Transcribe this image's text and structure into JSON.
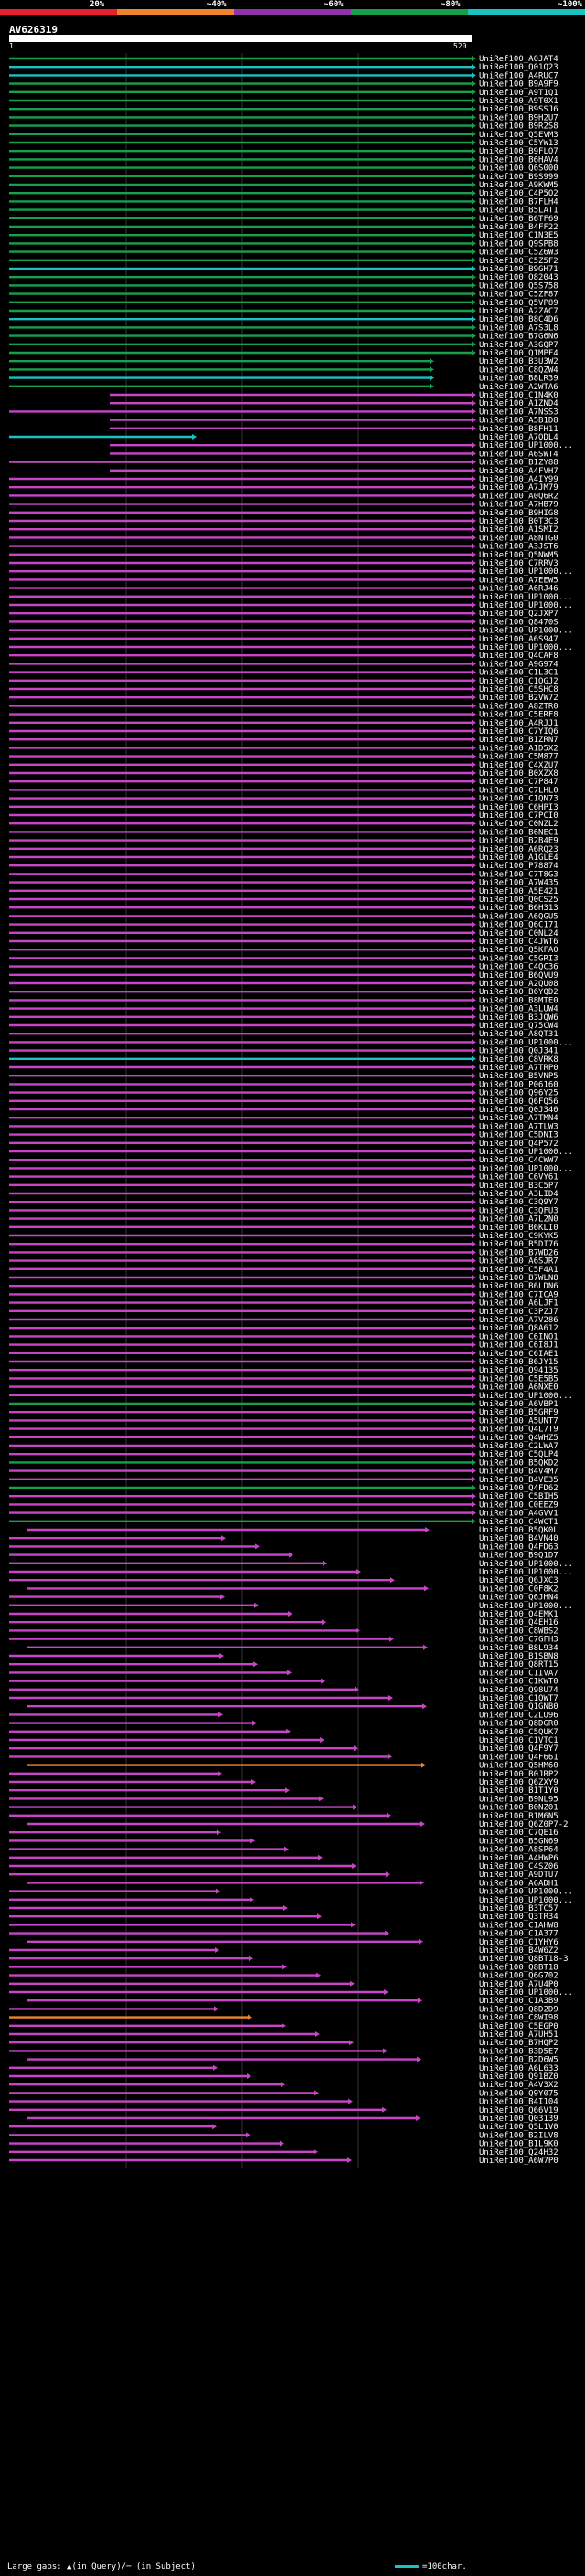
{
  "colorbar": {
    "labels": [
      "20%",
      "~40%",
      "~60%",
      "~80%",
      "~100%"
    ],
    "colors": [
      "#e8202a",
      "#f0842c",
      "#8c34a8",
      "#16a04a",
      "#17c3c3"
    ]
  },
  "query": {
    "name": "AV626319",
    "start": "1",
    "end": "520"
  },
  "colors": {
    "cyan": "#17c3c3",
    "green": "#16a04a",
    "magenta": "#c845c8",
    "orange": "#f0842c",
    "gapline": "#ff66ff"
  },
  "hits": [
    "UniRef100_A0JAT4",
    "UniRef100_Q01Q23",
    "UniRef100_A4RUC7",
    "UniRef100_B9A9F9",
    "UniRef100_A9T1Q1",
    "UniRef100_A9T0X1",
    "UniRef100_B9SSJ6",
    "UniRef100_B9H2U7",
    "UniRef100_B9R2S8",
    "UniRef100_Q5EVM3",
    "UniRef100_C5YW13",
    "UniRef100_B9FLQ7",
    "UniRef100_B6HAV4",
    "UniRef100_Q6S000",
    "UniRef100_B9S999",
    "UniRef100_A9KWM5",
    "UniRef100_C4P5Q2",
    "UniRef100_B7FLH4",
    "UniRef100_B5LAT1",
    "UniRef100_B6TF69",
    "UniRef100_B4FF22",
    "UniRef100_C1N3E5",
    "UniRef100_Q9SPB8",
    "UniRef100_C5Z6W3",
    "UniRef100_C5Z5F2",
    "UniRef100_B9GH71",
    "UniRef100_O82043",
    "UniRef100_Q5S758",
    "UniRef100_C5ZF87",
    "UniRef100_Q5VP89",
    "UniRef100_A2ZAC7",
    "UniRef100_B8C4D6",
    "UniRef100_A7S3L8",
    "UniRef100_B7G6N6",
    "UniRef100_A3GQP7",
    "UniRef100_Q1MPF4",
    "UniRef100_B3U3W2",
    "UniRef100_C8QZW4",
    "UniRef100_B8LR39",
    "UniRef100_A2WTA6",
    "UniRef100_C1N4K0",
    "UniRef100_A1ZND4",
    "UniRef100_A7NSS3",
    "UniRef100_A5B1D8",
    "UniRef100_B8FH11",
    "UniRef100_A7QDL4",
    "UniRef100_UP1000...",
    "UniRef100_A6SWT4",
    "UniRef100_B1ZY88",
    "UniRef100_A4FVH7",
    "UniRef100_A4IY99",
    "UniRef100_A7JM79",
    "UniRef100_A0Q6R2",
    "UniRef100_A7HB79",
    "UniRef100_B9HIG8",
    "UniRef100_B0T3C3",
    "UniRef100_A1SMI2",
    "UniRef100_A8NTG0",
    "UniRef100_A3JST6",
    "UniRef100_Q5NWM5",
    "UniRef100_C7RRV3",
    "UniRef100_UP1000...",
    "UniRef100_A7EEW5",
    "UniRef100_A6RJ46",
    "UniRef100_UP1000...",
    "UniRef100_UP1000...",
    "UniRef100_Q2JXP7",
    "UniRef100_Q8470S",
    "UniRef100_UP1000...",
    "UniRef100_A6S947",
    "UniRef100_UP1000...",
    "UniRef100_Q4CAF8",
    "UniRef100_A9G974",
    "UniRef100_C1L3C1",
    "UniRef100_C1QGJ2",
    "UniRef100_C5SHC8",
    "UniRef100_B2VW72",
    "UniRef100_A8ZTR0",
    "UniRef100_C5ERF8",
    "UniRef100_A4RJJ1",
    "UniRef100_C7YIQ6",
    "UniRef100_B1ZRN7",
    "UniRef100_A1D5X2",
    "UniRef100_C5M877",
    "UniRef100_C4XZU7",
    "UniRef100_B0XZX8",
    "UniRef100_C7P847",
    "UniRef100_C7LHL0",
    "UniRef100_C1QN73",
    "UniRef100_C6HPI3",
    "UniRef100_C7PCI0",
    "UniRef100_C0NZL2",
    "UniRef100_B6NEC1",
    "UniRef100_B2B4E9",
    "UniRef100_A6RQ23",
    "UniRef100_A1GLE4",
    "UniRef100_P78874",
    "UniRef100_C7T8G3",
    "UniRef100_A7W435",
    "UniRef100_A5E421",
    "UniRef100_Q0CS25",
    "UniRef100_B6H313",
    "UniRef100_A6QGU5",
    "UniRef100_Q6C171",
    "UniRef100_C0NL24",
    "UniRef100_C4JWT6",
    "UniRef100_Q5KFA0",
    "UniRef100_C5GRI3",
    "UniRef100_C4QC36",
    "UniRef100_B6QVU9",
    "UniRef100_A2QU08",
    "UniRef100_B6YQD2",
    "UniRef100_B8MTE0",
    "UniRef100_A3LUW4",
    "UniRef100_B3JQW6",
    "UniRef100_Q75CW4",
    "UniRef100_A8QT31",
    "UniRef100_UP1000...",
    "UniRef100_Q0J341",
    "UniRef100_C8VRK8",
    "UniRef100_A7TRP0",
    "UniRef100_B5VNP5",
    "UniRef100_P06160",
    "UniRef100_Q96Y25",
    "UniRef100_Q6FQ56",
    "UniRef100_Q0J340",
    "UniRef100_A7TMN4",
    "UniRef100_A7TLW3",
    "UniRef100_C5DNI3",
    "UniRef100_Q4P572",
    "UniRef100_UP1000...",
    "UniRef100_C4CWW7",
    "UniRef100_UP1000...",
    "UniRef100_C6VY61",
    "UniRef100_B3C5P7",
    "UniRef100_A3LID4",
    "UniRef100_C3Q9Y7",
    "UniRef100_C3QFU3",
    "UniRef100_A7L2N0",
    "UniRef100_B6KLI0",
    "UniRef100_C9KYK5",
    "UniRef100_B5DI76",
    "UniRef100_B7WD26",
    "UniRef100_A6SJR7",
    "UniRef100_C5F4A1",
    "UniRef100_B7WLN8",
    "UniRef100_B6LDN6",
    "UniRef100_C7ICA9",
    "UniRef100_A6LJF1",
    "UniRef100_C3PZJ7",
    "UniRef100_A7V286",
    "UniRef100_Q8A612",
    "UniRef100_C6INO1",
    "UniRef100_C6I8J1",
    "UniRef100_C6IAE1",
    "UniRef100_B6JY15",
    "UniRef100_Q94135",
    "UniRef100_C5E5B5",
    "UniRef100_A6NXE0",
    "UniRef100_UP1000...",
    "UniRef100_A6VBP1",
    "UniRef100_B5GRF9",
    "UniRef100_A5UNT7",
    "UniRef100_Q4L7T9",
    "UniRef100_Q4WHZ5",
    "UniRef100_C2LWA7",
    "UniRef100_C5QLP4",
    "UniRef100_B5QKD2",
    "UniRef100_B4V4M7",
    "UniRef100_B4VE35",
    "UniRef100_Q4FD62",
    "UniRef100_C5BIH5",
    "UniRef100_C0EEZ9",
    "UniRef100_A4GVV1",
    "UniRef100_C4WCT1",
    "UniRef100_B5QK0L",
    "UniRef100_B4VN40",
    "UniRef100_Q4FD63",
    "UniRef100_B9Q1D7",
    "UniRef100_UP1000...",
    "UniRef100_UP1000...",
    "UniRef100_Q6JXC3",
    "UniRef100_C0F8K2",
    "UniRef100_Q6JHN4",
    "UniRef100_UP1000...",
    "UniRef100_Q4EMK1",
    "UniRef100_Q4EH16",
    "UniRef100_C8WBS2",
    "UniRef100_C7GFH3",
    "UniRef100_B8L934",
    "UniRef100_B1SBN8",
    "UniRef100_Q8RT15",
    "UniRef100_C1IVA7",
    "UniRef100_C1KWT0",
    "UniRef100_Q98U74",
    "UniRef100_C1QWT7",
    "UniRef100_Q1GNB0",
    "UniRef100_C2LU96",
    "UniRef100_Q8DGR0",
    "UniRef100_C5QUK7",
    "UniRef100_C1VTC1",
    "UniRef100_Q4F9Y7",
    "UniRef100_Q4F661",
    "UniRef100_Q5HM60",
    "UniRef100_B0JRP2",
    "UniRef100_Q6ZXY9",
    "UniRef100_B1T1Y0",
    "UniRef100_B9NL95",
    "UniRef100_B0NZ01",
    "UniRef100_B1M6N5",
    "UniRef100_Q6Z0P7-2",
    "UniRef100_C7QE16",
    "UniRef100_B5GN69",
    "UniRef100_A8SP64",
    "UniRef100_A4HWP6",
    "UniRef100_C4SZ06",
    "UniRef100_A9DTU7",
    "UniRef100_A6ADH1",
    "UniRef100_UP1000...",
    "UniRef100_UP1000...",
    "UniRef100_B3TC57",
    "UniRef100_Q3TR34",
    "UniRef100_C1AHW8",
    "UniRef100_C1A377",
    "UniRef100_C1YHY6",
    "UniRef100_B4W6Z2",
    "UniRef100_Q8BT18-3",
    "UniRef100_Q8BT18",
    "UniRef100_Q6G702",
    "UniRef100_A7U4P0",
    "UniRef100_UP1000...",
    "UniRef100_C1A3B9",
    "UniRef100_Q8D2D9",
    "UniRef100_C8WI98",
    "UniRef100_C5EGP0",
    "UniRef100_A7UH51",
    "UniRef100_B7HQP2",
    "UniRef100_B3D5E7",
    "UniRef100_B2D6W5",
    "UniRef100_A6L633",
    "UniRef100_Q91BZ0",
    "UniRef100_A4V3X2",
    "UniRef100_Q9Y075",
    "UniRef100_B4I104",
    "UniRef100_Q66V19",
    "UniRef100_Q03139",
    "UniRef100_Q5L1V0",
    "UniRef100_B2ILV8",
    "UniRef100_B1L9K0",
    "UniRef100_Q24H32",
    "UniRef100_A6W7P0"
  ],
  "footer": {
    "gaps_text": "Large gaps: ▲(in Query)/─ (in Subject)",
    "scale_text": "=100char."
  }
}
